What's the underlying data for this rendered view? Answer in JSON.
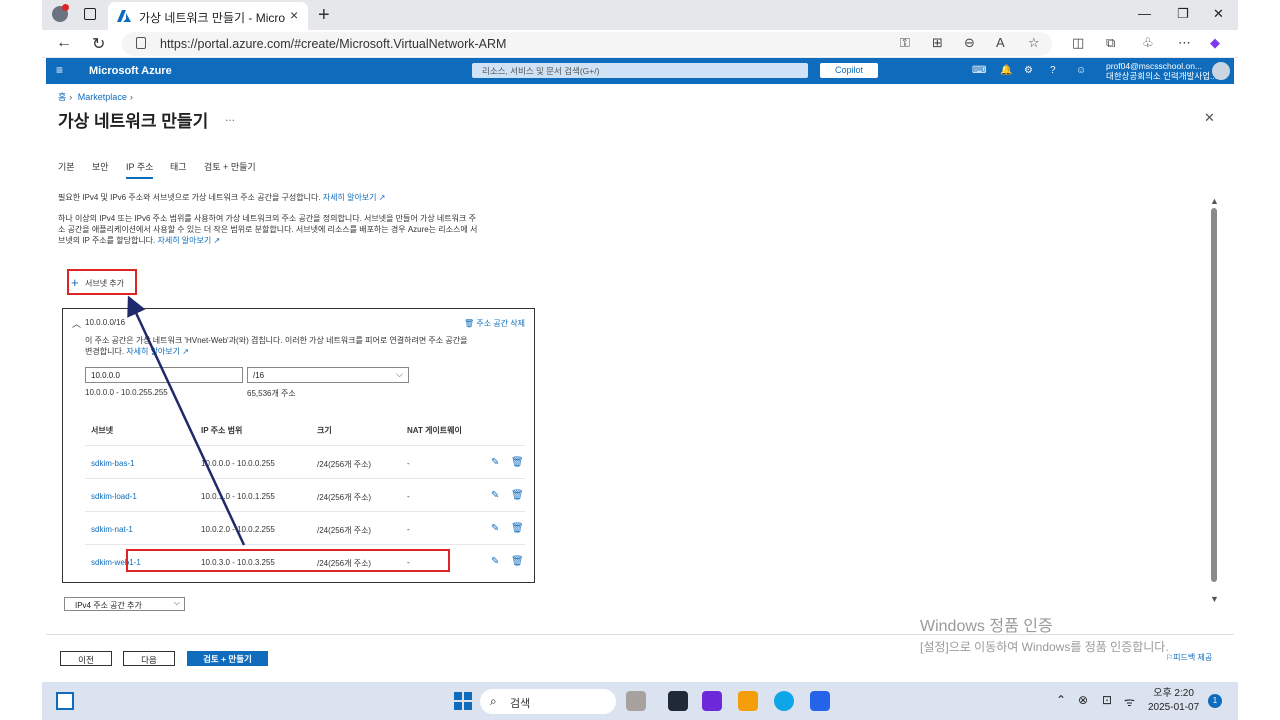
{
  "browser": {
    "tab_title": "가상 네트워크 만들기 - Microsoft",
    "url": "https://portal.azure.com/#create/Microsoft.VirtualNetwork-ARM"
  },
  "azure": {
    "brand": "Microsoft Azure",
    "search_placeholder": "리소스, 서비스 및 문서 검색(G+/)",
    "copilot": "Copilot",
    "user_email": "prof04@mscsschool.on...",
    "user_org": "대한상공회의소 인력개발사업..."
  },
  "breadcrumb": {
    "home": "홈",
    "marketplace": "Marketplace"
  },
  "page": {
    "title": "가상 네트워크 만들기",
    "more": "..."
  },
  "tabs": [
    "기본",
    "보안",
    "IP 주소",
    "태그",
    "검토 + 만들기"
  ],
  "active_tab": "IP 주소",
  "intro": {
    "line1": "필요한 IPv4 및 IPv6 주소와 서브넷으로 가상 네트워크 주소 공간을 구성합니다.",
    "link1": "자세히 알아보기",
    "para2a": "하나 이상의 IPv4 또는 IPv6 주소 범위를 사용하여 가상 네트워크의 주소 공간을 정의합니다. 서브넷을 만들어 가상 네트워크 주",
    "para2b": "소 공간을 애플리케이션에서 사용할 수 있는 더 작은 범위로 분할합니다. 서브넷에 리소스를 배포하는 경우 Azure는 리소스에 서",
    "para2c": "브넷의 IP 주소를 할당합니다.",
    "link2": "자세히 알아보기"
  },
  "add_subnet": "서브넷 추가",
  "address_space": {
    "cidr": "10.0.0.0/16",
    "delete": "주소 공간 삭제",
    "warning_a": "이 주소 공간은 가상 네트워크 'HVnet-Web'과(와) 겹칩니다. 이러한 가상 네트워크를 피어로 연결하려면 주소 공간을",
    "warning_b": "변경합니다.",
    "warning_link": "자세히 알아보기",
    "ip": "10.0.0.0",
    "prefix": "/16",
    "range": "10.0.0.0 - 10.0.255.255",
    "count": "65,536개 주소"
  },
  "subnet_table": {
    "headers": [
      "서브넷",
      "IP 주소 범위",
      "크기",
      "NAT 게이트웨이"
    ],
    "rows": [
      {
        "name": "sdkim-bas-1",
        "range": "10.0.0.0 - 10.0.0.255",
        "size": "/24(256개 주소)",
        "nat": "-"
      },
      {
        "name": "sdkim-load-1",
        "range": "10.0.1.0 - 10.0.1.255",
        "size": "/24(256개 주소)",
        "nat": "-"
      },
      {
        "name": "sdkim-nat-1",
        "range": "10.0.2.0 - 10.0.2.255",
        "size": "/24(256개 주소)",
        "nat": "-"
      },
      {
        "name": "sdkim-web1-1",
        "range": "10.0.3.0 - 10.0.3.255",
        "size": "/24(256개 주소)",
        "nat": "-"
      }
    ]
  },
  "ipv4_add": "IPv4 주소 공간 추가",
  "footer": {
    "prev": "이전",
    "next": "다음",
    "review": "검토 + 만들기",
    "feedback": "피드백 제공"
  },
  "watermark": {
    "title": "Windows 정품 인증",
    "sub": "[설정]으로 이동하여 Windows를 정품 인증합니다."
  },
  "taskbar": {
    "search": "검색",
    "time": "오후 2:20",
    "date": "2025-01-07",
    "notif_count": "1"
  },
  "colors": {
    "azure_blue": "#0f6cbd",
    "highlight_red": "#dc2626",
    "arrow_navy": "#1e2a6b"
  }
}
